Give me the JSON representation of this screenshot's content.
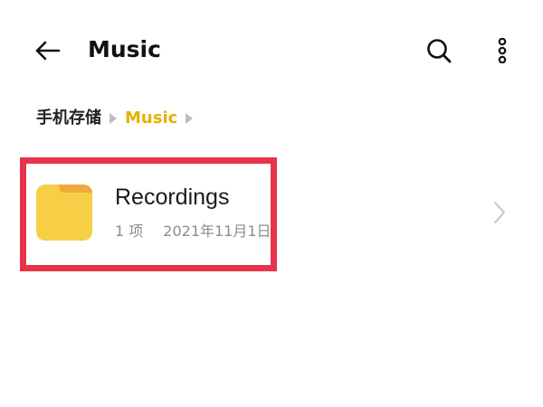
{
  "app_bar": {
    "back_icon": "arrow-left-icon",
    "title": "Music",
    "search_icon": "search-icon",
    "more_icon": "more-vertical-icon"
  },
  "breadcrumb": {
    "items": [
      {
        "label": "手机存储",
        "current": false
      },
      {
        "label": "Music",
        "current": true
      }
    ],
    "separator_icon": "triangle-right-icon"
  },
  "list": {
    "items": [
      {
        "icon": "folder-icon",
        "name": "Recordings",
        "count": "1 项",
        "date": "2021年11月1日",
        "chevron_icon": "chevron-right-icon"
      }
    ]
  },
  "colors": {
    "accent": "#e5b100",
    "folder_body": "#f7cf47",
    "folder_tab": "#f0a93a",
    "highlight": "#e8334a",
    "meta_text": "#8c8c8c"
  }
}
